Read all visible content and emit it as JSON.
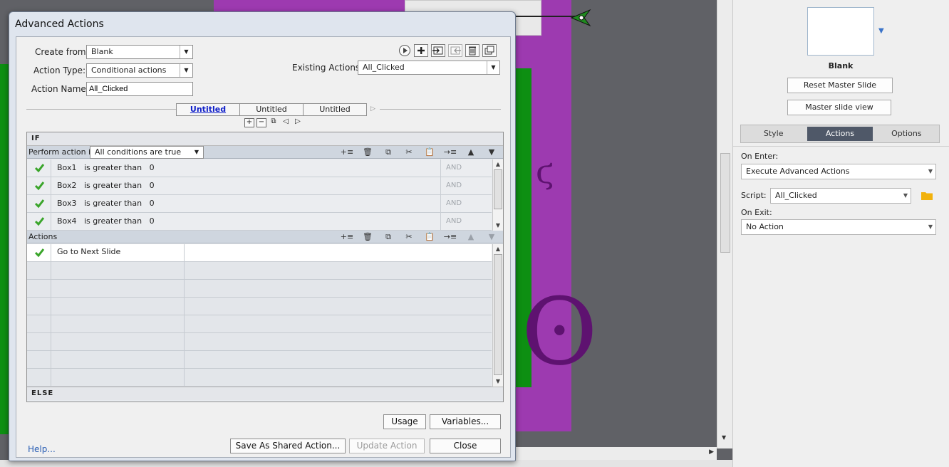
{
  "dialog": {
    "title": "Advanced Actions",
    "create_from_label": "Create from:",
    "create_from_value": "Blank",
    "action_type_label": "Action Type:",
    "action_type_value": "Conditional actions",
    "action_name_label": "Action Name:",
    "action_name_value": "All_Clicked",
    "existing_actions_label": "Existing Actions:",
    "existing_actions_value": "All_Clicked",
    "toolbar_icons": [
      "preview-icon",
      "add-icon",
      "import-icon",
      "export-icon",
      "delete-icon",
      "duplicate-icon"
    ],
    "case_tabs": [
      {
        "label": "Untitled",
        "active": true
      },
      {
        "label": "Untitled",
        "active": false
      },
      {
        "label": "Untitled",
        "active": false
      }
    ],
    "case_controls": [
      "+",
      "−",
      "⧉",
      "◁",
      "▷"
    ],
    "if_label": "IF",
    "perform_if_label": "Perform action if:",
    "perform_if_value": "All conditions are true",
    "conditions": [
      {
        "var": "Box1",
        "op": "is greater than",
        "val": "0",
        "join": "AND"
      },
      {
        "var": "Box2",
        "op": "is greater than",
        "val": "0",
        "join": "AND"
      },
      {
        "var": "Box3",
        "op": "is greater than",
        "val": "0",
        "join": "AND"
      },
      {
        "var": "Box4",
        "op": "is greater than",
        "val": "0",
        "join": "AND"
      }
    ],
    "actions_label": "Actions",
    "actions": [
      {
        "name": "Go to Next Slide"
      }
    ],
    "else_label": "ELSE",
    "buttons": {
      "usage": "Usage",
      "variables": "Variables...",
      "save_shared": "Save As Shared Action...",
      "update": "Update Action",
      "close": "Close"
    },
    "help": "Help..."
  },
  "panel": {
    "thumb_label": "Blank",
    "reset_master": "Reset Master Slide",
    "master_view": "Master slide view",
    "tabs": [
      {
        "label": "Style",
        "active": false
      },
      {
        "label": "Actions",
        "active": true
      },
      {
        "label": "Options",
        "active": false
      }
    ],
    "on_enter_label": "On Enter:",
    "on_enter_value": "Execute Advanced Actions",
    "script_label": "Script:",
    "script_value": "All_Clicked",
    "on_exit_label": "On Exit:",
    "on_exit_value": "No Action"
  },
  "colors": {
    "slide_purple": "#9d3ab0",
    "slide_green": "#0d8f12",
    "active_tab": "#4f5868",
    "check_green": "#3aa52a",
    "link_blue": "#2b5fb4"
  }
}
